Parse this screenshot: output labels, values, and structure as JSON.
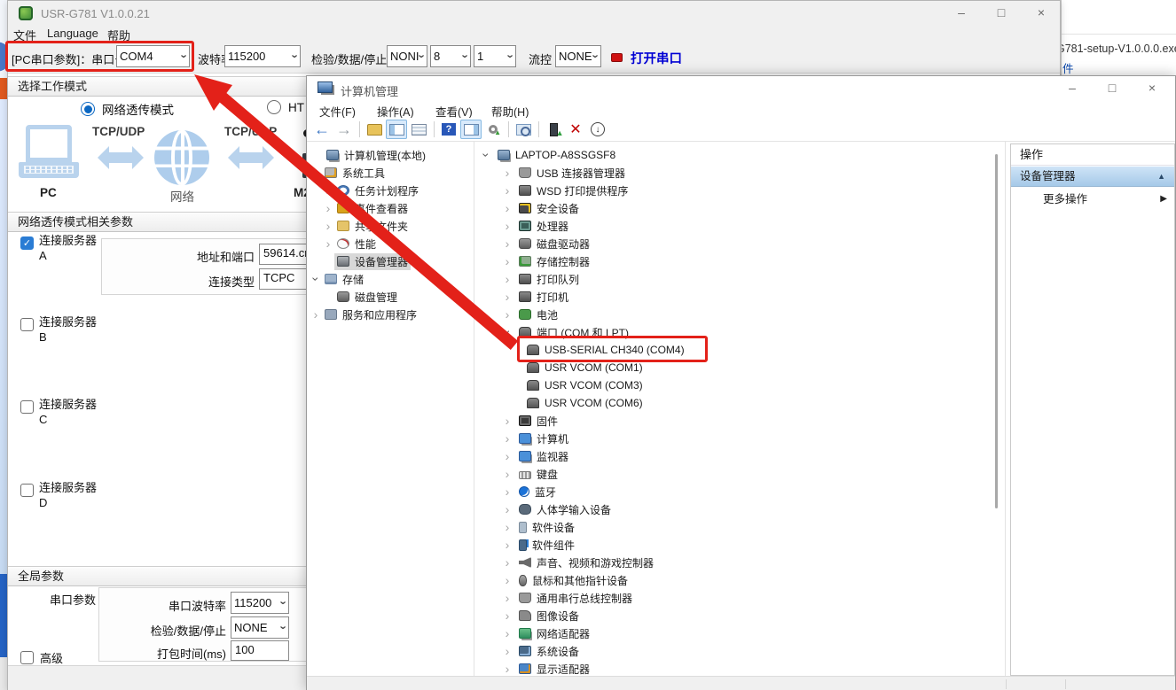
{
  "chrome": {
    "minimize": "–",
    "maximize": "□",
    "close": "×"
  },
  "background": {
    "exe_text": "G781-setup-V1.0.0.0.exe",
    "link_text": "件"
  },
  "usr": {
    "title": "USR-G781 V1.0.0.21",
    "menu": [
      "文件",
      "Language",
      "帮助"
    ],
    "serial": {
      "port_label": "[PC串口参数]：串口号",
      "port_value": "COM4",
      "baud_label": "波特率",
      "baud_value": "115200",
      "parity_label": "检验/数据/停止",
      "parity_value": "NONI",
      "databits_value": "8",
      "stopbits_value": "1",
      "flow_label": "流控",
      "flow_value": "NONE",
      "open_button": "打开串口"
    },
    "workmode": {
      "header": "选择工作模式",
      "mode1": "网络透传模式",
      "mode2": "HT",
      "pc_label": "PC",
      "net_label": "网络",
      "m2_label": "M2",
      "link1": "TCP/UDP",
      "link2": "TCP/UDP"
    },
    "netparams": {
      "header": "网络透传模式相关参数",
      "servers": [
        {
          "label": "连接服务器",
          "letter": "A",
          "checked": true
        },
        {
          "label": "连接服务器",
          "letter": "B",
          "checked": false
        },
        {
          "label": "连接服务器",
          "letter": "C",
          "checked": false
        },
        {
          "label": "连接服务器",
          "letter": "D",
          "checked": false
        }
      ],
      "addr_label": "地址和端口",
      "addr_value": "59614.cr",
      "type_label": "连接类型",
      "type_value": "TCPC"
    },
    "globalparams": {
      "header": "全局参数",
      "serial_group_label": "串口参数",
      "baud_label": "串口波特率",
      "baud_value": "115200",
      "parity_label": "检验/数据/停止",
      "parity_value": "NONE",
      "pack_label": "打包时间(ms)",
      "pack_value": "100",
      "advanced_label": "高级"
    }
  },
  "cm": {
    "title": "计算机管理",
    "menu": [
      "文件(F)",
      "操作(A)",
      "查看(V)",
      "帮助(H)"
    ],
    "toolbar": [
      {
        "icon": "back"
      },
      {
        "icon": "forward"
      },
      {
        "icon": "sep"
      },
      {
        "icon": "export-folder"
      },
      {
        "icon": "console-tree",
        "hl": true
      },
      {
        "icon": "properties"
      },
      {
        "icon": "sep"
      },
      {
        "icon": "help"
      },
      {
        "icon": "action-pane",
        "hl": true
      },
      {
        "icon": "gear-up"
      },
      {
        "icon": "sep"
      },
      {
        "icon": "scan-devices"
      },
      {
        "icon": "sep"
      },
      {
        "icon": "update-driver"
      },
      {
        "icon": "uninstall-x"
      },
      {
        "icon": "disable-down"
      }
    ],
    "left_tree": [
      {
        "indent": 0,
        "expander": "",
        "icon": "computer-mgmt",
        "label": "计算机管理(本地)"
      },
      {
        "indent": 1,
        "expander": "v",
        "icon": "system-tools",
        "label": "系统工具"
      },
      {
        "indent": 2,
        "expander": ">",
        "icon": "task-scheduler",
        "label": "任务计划程序"
      },
      {
        "indent": 2,
        "expander": ">",
        "icon": "event-viewer",
        "label": "事件查看器"
      },
      {
        "indent": 2,
        "expander": ">",
        "icon": "shared-folders",
        "label": "共享文件夹"
      },
      {
        "indent": 2,
        "expander": ">",
        "icon": "performance",
        "label": "性能"
      },
      {
        "indent": 2,
        "expander": "",
        "icon": "device-manager",
        "label": "设备管理器",
        "selected": true
      },
      {
        "indent": 1,
        "expander": "v",
        "icon": "storage",
        "label": "存储"
      },
      {
        "indent": 2,
        "expander": "",
        "icon": "disk-mgmt",
        "label": "磁盘管理"
      },
      {
        "indent": 1,
        "expander": ">",
        "icon": "services",
        "label": "服务和应用程序"
      }
    ],
    "device_tree": [
      {
        "indent": 0,
        "expander": "v",
        "icon": "computer",
        "label": "LAPTOP-A8SSGSF8"
      },
      {
        "indent": 1,
        "expander": ">",
        "icon": "usb",
        "label": "USB 连接器管理器"
      },
      {
        "indent": 1,
        "expander": ">",
        "icon": "printer",
        "label": "WSD 打印提供程序"
      },
      {
        "indent": 1,
        "expander": ">",
        "icon": "security",
        "label": "安全设备"
      },
      {
        "indent": 1,
        "expander": ">",
        "icon": "cpu",
        "label": "处理器"
      },
      {
        "indent": 1,
        "expander": ">",
        "icon": "disk",
        "label": "磁盘驱动器"
      },
      {
        "indent": 1,
        "expander": ">",
        "icon": "storage-ctrl",
        "label": "存储控制器"
      },
      {
        "indent": 1,
        "expander": ">",
        "icon": "printer",
        "label": "打印队列"
      },
      {
        "indent": 1,
        "expander": ">",
        "icon": "printer",
        "label": "打印机"
      },
      {
        "indent": 1,
        "expander": ">",
        "icon": "battery",
        "label": "电池"
      },
      {
        "indent": 1,
        "expander": "v",
        "icon": "serial-port",
        "label": "端口 (COM 和 LPT)"
      },
      {
        "indent": 2,
        "expander": "",
        "icon": "serial-port",
        "label": "USB-SERIAL CH340 (COM4)",
        "boxed": true
      },
      {
        "indent": 2,
        "expander": "",
        "icon": "serial-port",
        "label": "USR VCOM (COM1)"
      },
      {
        "indent": 2,
        "expander": "",
        "icon": "serial-port",
        "label": "USR VCOM (COM3)"
      },
      {
        "indent": 2,
        "expander": "",
        "icon": "serial-port",
        "label": "USR VCOM (COM6)"
      },
      {
        "indent": 1,
        "expander": ">",
        "icon": "firmware",
        "label": "固件"
      },
      {
        "indent": 1,
        "expander": ">",
        "icon": "monitor",
        "label": "计算机"
      },
      {
        "indent": 1,
        "expander": ">",
        "icon": "monitor",
        "label": "监视器"
      },
      {
        "indent": 1,
        "expander": ">",
        "icon": "keyboard",
        "label": "键盘"
      },
      {
        "indent": 1,
        "expander": ">",
        "icon": "bluetooth",
        "label": "蓝牙"
      },
      {
        "indent": 1,
        "expander": ">",
        "icon": "hid",
        "label": "人体学输入设备"
      },
      {
        "indent": 1,
        "expander": ">",
        "icon": "software-device",
        "label": "软件设备"
      },
      {
        "indent": 1,
        "expander": ">",
        "icon": "software-component",
        "label": "软件组件"
      },
      {
        "indent": 1,
        "expander": ">",
        "icon": "audio",
        "label": "声音、视频和游戏控制器"
      },
      {
        "indent": 1,
        "expander": ">",
        "icon": "mouse",
        "label": "鼠标和其他指针设备"
      },
      {
        "indent": 1,
        "expander": ">",
        "icon": "usb",
        "label": "通用串行总线控制器"
      },
      {
        "indent": 1,
        "expander": ">",
        "icon": "imaging",
        "label": "图像设备"
      },
      {
        "indent": 1,
        "expander": ">",
        "icon": "network",
        "label": "网络适配器"
      },
      {
        "indent": 1,
        "expander": ">",
        "icon": "system-devices",
        "label": "系统设备"
      },
      {
        "indent": 1,
        "expander": ">",
        "icon": "display-adapter",
        "label": "显示适配器"
      }
    ],
    "actions": {
      "header": "操作",
      "section": "设备管理器",
      "collapse_glyph": "▲",
      "more": "更多操作",
      "more_glyph": "▶"
    }
  },
  "colors": {
    "annotation_red": "#e32119",
    "link_blue": "#0000d4",
    "selection_blue": "#0b67c2"
  }
}
